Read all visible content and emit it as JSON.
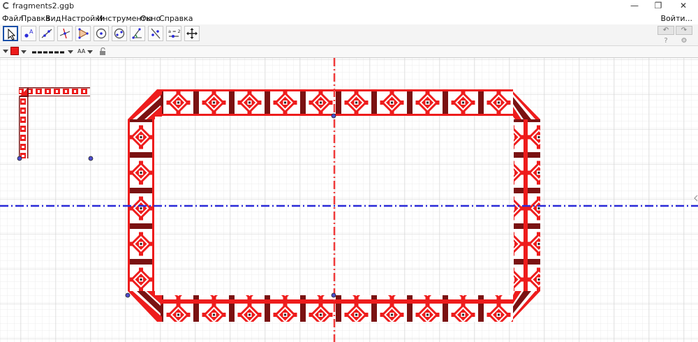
{
  "window": {
    "title": "fragments2.ggb",
    "minimize": "—",
    "restore": "❐",
    "close": "✕"
  },
  "menu": {
    "items": [
      "Файл",
      "Правка",
      "Вид",
      "Настройки",
      "Инструменты",
      "Окно",
      "Справка"
    ],
    "signin": "Войти..."
  },
  "toolbar": {
    "tools": [
      "move-tool",
      "point-tool",
      "line-tool",
      "perpendicular-line-tool",
      "polygon-tool",
      "circle-tool",
      "conic-tool",
      "angle-tool",
      "reflect-tool",
      "slider-tool",
      "move-view-tool"
    ],
    "slider_label": "a = 2",
    "undo": "↶",
    "redo": "↷",
    "help_icon": "?",
    "settings_icon": "⚙"
  },
  "stylebar": {
    "text_size_label": "AA"
  },
  "colors": {
    "embroidery_red": "#ee1c1c",
    "embroidery_dark": "#7a1212",
    "x_axis": "#2b2bd9",
    "y_axis": "#f03a3a",
    "point": "#4d4dcc",
    "grid_minor": "#eeeeee",
    "grid_major": "#d2d2d2"
  }
}
